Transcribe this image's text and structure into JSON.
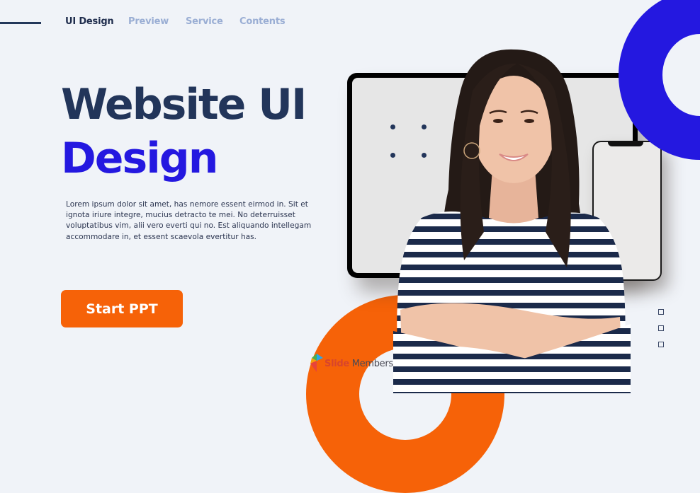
{
  "nav": {
    "items": [
      {
        "label": "UI Design",
        "active": true
      },
      {
        "label": "Preview",
        "active": false
      },
      {
        "label": "Service",
        "active": false
      },
      {
        "label": "Contents",
        "active": false
      }
    ]
  },
  "hero": {
    "title_line1": "Website UI",
    "title_line2": "Design",
    "body": "Lorem ipsum dolor sit amet, has nemore essent eirmod in. Sit et ignota iriure integre, mucius detracto te mei. No deterruisset voluptatibus vim, alii vero everti qui no. Est aliquando intellegam accommodare in, et essent scaevola evertitur has.",
    "cta_label": "Start PPT"
  },
  "logo": {
    "brand_bold": "Slide",
    "brand_regular": " Members"
  },
  "colors": {
    "primary_blue": "#2418e0",
    "navy": "#22355a",
    "orange": "#f66208",
    "nav_inactive": "#9aaed4",
    "background": "#f0f3f8"
  },
  "images": {
    "person": "smiling-woman-striped-shirt-arms-crossed",
    "devices": "tablet-and-phone-mockup"
  }
}
